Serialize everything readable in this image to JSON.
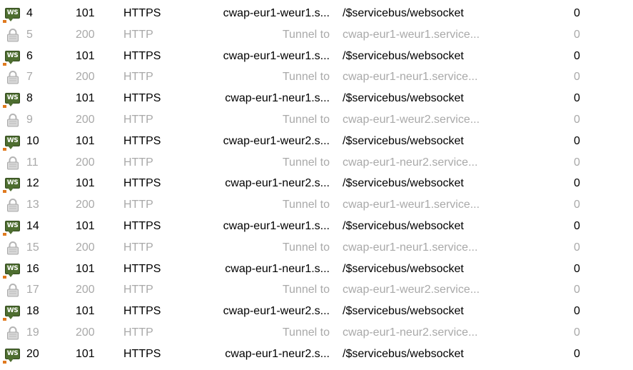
{
  "colors": {
    "websocket_icon": "#4e6e30",
    "websocket_badge": "#e07a1f",
    "tunnel_text": "#a9a9a9",
    "normal_text": "#000000"
  },
  "sessions": [
    {
      "icon": "websocket-icon",
      "icon_label": "WS",
      "num": "4",
      "result": "101",
      "protocol": "HTTPS",
      "host": "cwap-eur1-weur1.s...",
      "url": "/$servicebus/websocket",
      "body": "0",
      "tunnel": false
    },
    {
      "icon": "lock-icon",
      "icon_label": "",
      "num": "5",
      "result": "200",
      "protocol": "HTTP",
      "host": "Tunnel to",
      "url": "cwap-eur1-weur1.service...",
      "body": "0",
      "tunnel": true
    },
    {
      "icon": "websocket-icon",
      "icon_label": "WS",
      "num": "6",
      "result": "101",
      "protocol": "HTTPS",
      "host": "cwap-eur1-weur1.s...",
      "url": "/$servicebus/websocket",
      "body": "0",
      "tunnel": false
    },
    {
      "icon": "lock-icon",
      "icon_label": "",
      "num": "7",
      "result": "200",
      "protocol": "HTTP",
      "host": "Tunnel to",
      "url": "cwap-eur1-neur1.service...",
      "body": "0",
      "tunnel": true
    },
    {
      "icon": "websocket-icon",
      "icon_label": "WS",
      "num": "8",
      "result": "101",
      "protocol": "HTTPS",
      "host": "cwap-eur1-neur1.s...",
      "url": "/$servicebus/websocket",
      "body": "0",
      "tunnel": false
    },
    {
      "icon": "lock-icon",
      "icon_label": "",
      "num": "9",
      "result": "200",
      "protocol": "HTTP",
      "host": "Tunnel to",
      "url": "cwap-eur1-weur2.service...",
      "body": "0",
      "tunnel": true
    },
    {
      "icon": "websocket-icon",
      "icon_label": "WS",
      "num": "10",
      "result": "101",
      "protocol": "HTTPS",
      "host": "cwap-eur1-weur2.s...",
      "url": "/$servicebus/websocket",
      "body": "0",
      "tunnel": false
    },
    {
      "icon": "lock-icon",
      "icon_label": "",
      "num": "11",
      "result": "200",
      "protocol": "HTTP",
      "host": "Tunnel to",
      "url": "cwap-eur1-neur2.service...",
      "body": "0",
      "tunnel": true
    },
    {
      "icon": "websocket-icon",
      "icon_label": "WS",
      "num": "12",
      "result": "101",
      "protocol": "HTTPS",
      "host": "cwap-eur1-neur2.s...",
      "url": "/$servicebus/websocket",
      "body": "0",
      "tunnel": false
    },
    {
      "icon": "lock-icon",
      "icon_label": "",
      "num": "13",
      "result": "200",
      "protocol": "HTTP",
      "host": "Tunnel to",
      "url": "cwap-eur1-weur1.service...",
      "body": "0",
      "tunnel": true
    },
    {
      "icon": "websocket-icon",
      "icon_label": "WS",
      "num": "14",
      "result": "101",
      "protocol": "HTTPS",
      "host": "cwap-eur1-weur1.s...",
      "url": "/$servicebus/websocket",
      "body": "0",
      "tunnel": false
    },
    {
      "icon": "lock-icon",
      "icon_label": "",
      "num": "15",
      "result": "200",
      "protocol": "HTTP",
      "host": "Tunnel to",
      "url": "cwap-eur1-neur1.service...",
      "body": "0",
      "tunnel": true
    },
    {
      "icon": "websocket-icon",
      "icon_label": "WS",
      "num": "16",
      "result": "101",
      "protocol": "HTTPS",
      "host": "cwap-eur1-neur1.s...",
      "url": "/$servicebus/websocket",
      "body": "0",
      "tunnel": false
    },
    {
      "icon": "lock-icon",
      "icon_label": "",
      "num": "17",
      "result": "200",
      "protocol": "HTTP",
      "host": "Tunnel to",
      "url": "cwap-eur1-weur2.service...",
      "body": "0",
      "tunnel": true
    },
    {
      "icon": "websocket-icon",
      "icon_label": "WS",
      "num": "18",
      "result": "101",
      "protocol": "HTTPS",
      "host": "cwap-eur1-weur2.s...",
      "url": "/$servicebus/websocket",
      "body": "0",
      "tunnel": false
    },
    {
      "icon": "lock-icon",
      "icon_label": "",
      "num": "19",
      "result": "200",
      "protocol": "HTTP",
      "host": "Tunnel to",
      "url": "cwap-eur1-neur2.service...",
      "body": "0",
      "tunnel": true
    },
    {
      "icon": "websocket-icon",
      "icon_label": "WS",
      "num": "20",
      "result": "101",
      "protocol": "HTTPS",
      "host": "cwap-eur1-neur2.s...",
      "url": "/$servicebus/websocket",
      "body": "0",
      "tunnel": false
    }
  ]
}
